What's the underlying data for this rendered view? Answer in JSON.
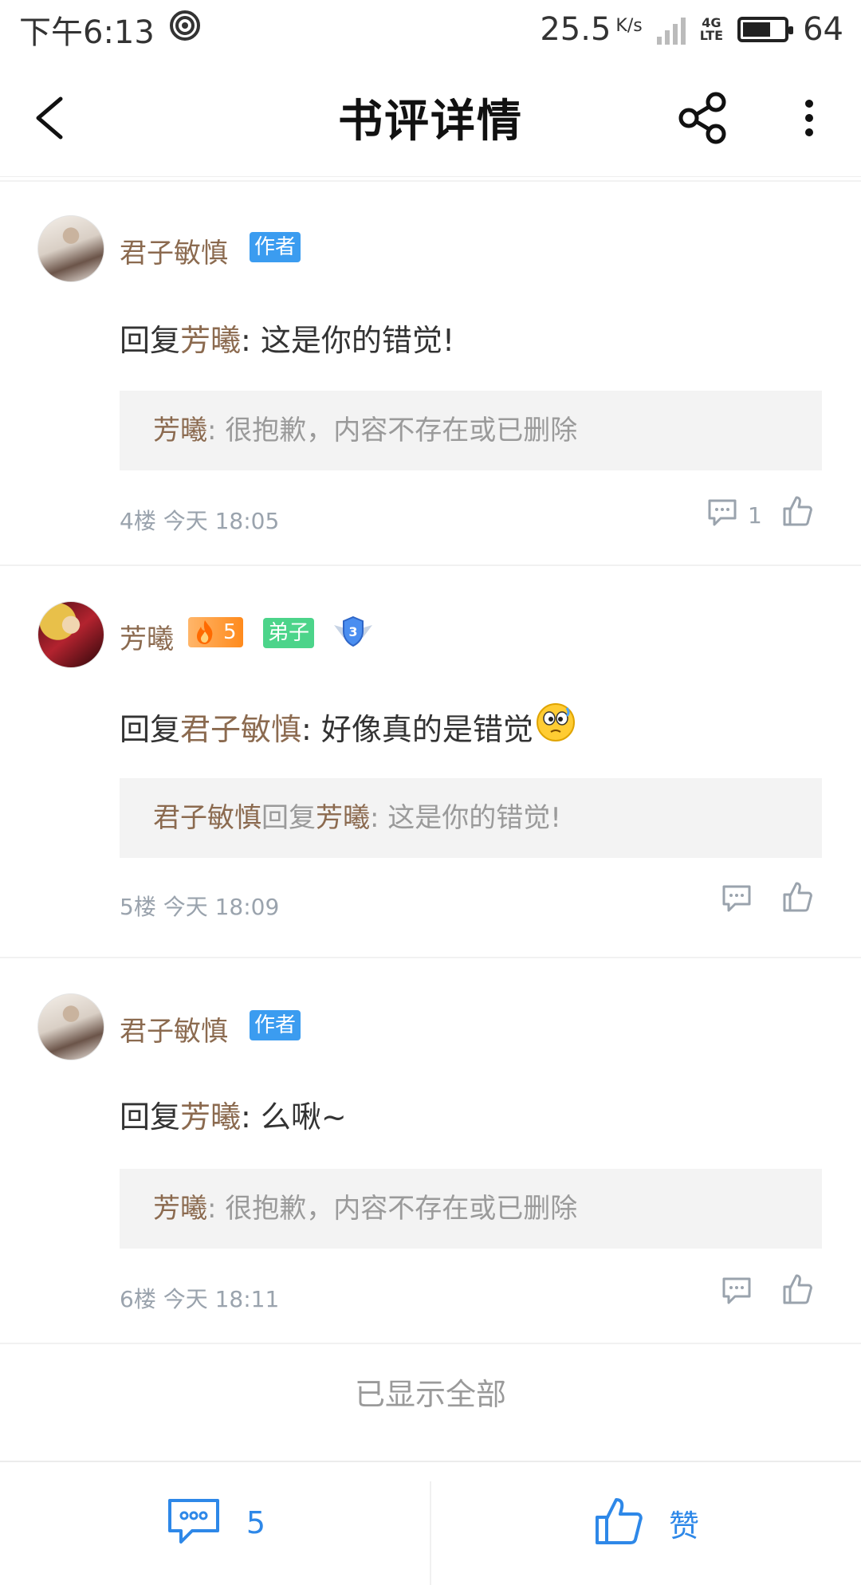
{
  "status_bar": {
    "time": "下午6:13",
    "speed": "25.5",
    "speed_unit": "K/s",
    "network": "4G",
    "network_sub": "LTE",
    "battery": "64"
  },
  "header": {
    "title": "书评详情",
    "icons": [
      "back-arrow-icon",
      "share-icon",
      "more-vertical-icon"
    ]
  },
  "comments": [
    {
      "username": "君子敏慎",
      "badges": [
        "作者"
      ],
      "reply_prefix": "回复",
      "reply_to": "芳曦",
      "reply_text": ": 这是你的错觉!",
      "quote_name": "芳曦",
      "quote_text": ": 很抱歉，内容不存在或已删除",
      "floor_time": "4楼 今天 18:05",
      "reply_count": "1"
    },
    {
      "username": "芳曦",
      "fire_level": "5",
      "badges": [
        "弟子"
      ],
      "shield_level": "3",
      "reply_prefix": "回复",
      "reply_to": "君子敏慎",
      "reply_text": ": 好像真的是错觉",
      "quote_name": "君子敏慎",
      "quote_mid": "回复",
      "quote_name2": "芳曦",
      "quote_text": ": 这是你的错觉!",
      "floor_time": "5楼 今天 18:09"
    },
    {
      "username": "君子敏慎",
      "badges": [
        "作者"
      ],
      "reply_prefix": "回复",
      "reply_to": "芳曦",
      "reply_text": ": 么啾~",
      "quote_name": "芳曦",
      "quote_text": ": 很抱歉，内容不存在或已删除",
      "floor_time": "6楼 今天 18:11"
    }
  ],
  "footer_note": "已显示全部",
  "bottom_bar": {
    "comment_count": "5",
    "like_label": "赞"
  },
  "colors": {
    "username_brown": "#8b6a4f",
    "author_badge": "#3b9cf0",
    "disciple_badge": "#4cd48a",
    "accent_blue": "#2e88e8",
    "meta_gray": "#9aa3ad"
  }
}
